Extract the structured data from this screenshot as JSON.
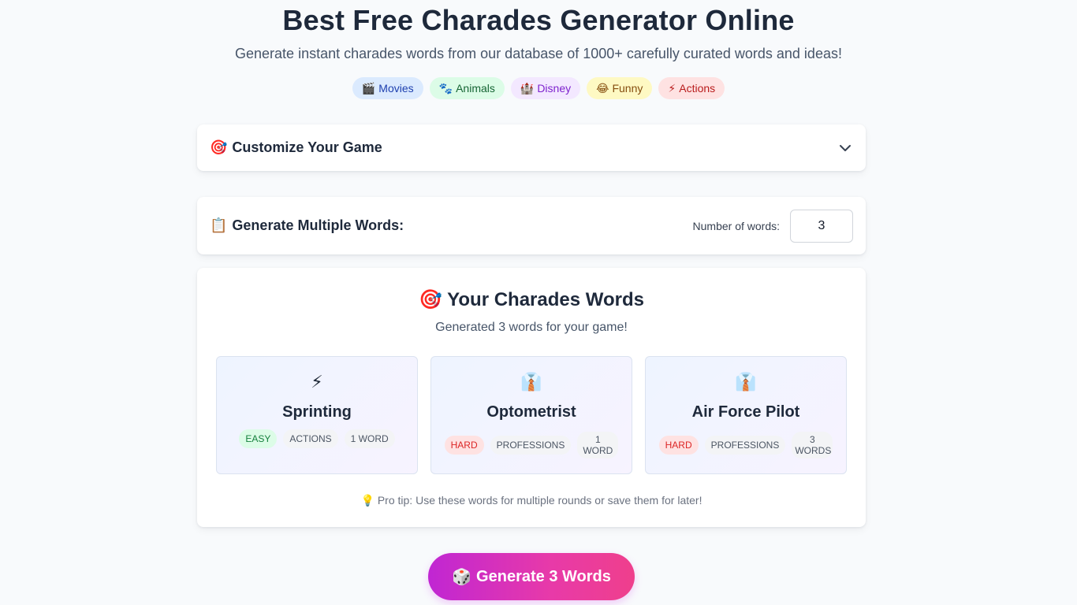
{
  "hero": {
    "title": "Best Free Charades Generator Online",
    "subtitle": "Generate instant charades words from our database of 1000+ carefully curated words and ideas!"
  },
  "categories": [
    {
      "icon": "🎬",
      "label": "Movies"
    },
    {
      "icon": "🐾",
      "label": "Animals"
    },
    {
      "icon": "🏰",
      "label": "Disney"
    },
    {
      "icon": "😂",
      "label": "Funny"
    },
    {
      "icon": "⚡",
      "label": "Actions"
    }
  ],
  "customize": {
    "icon": "🎯",
    "label": "Customize Your Game"
  },
  "multiple": {
    "icon": "📋",
    "label": "Generate Multiple Words:",
    "count_label": "Number of words:",
    "count_value": "3"
  },
  "results": {
    "icon": "🎯",
    "title": "Your Charades Words",
    "subtitle": "Generated 3 words for your game!",
    "words": [
      {
        "icon": "⚡",
        "word": "Sprinting",
        "difficulty": "EASY",
        "category": "ACTIONS",
        "length": "1 WORD"
      },
      {
        "icon": "👔",
        "word": "Optometrist",
        "difficulty": "HARD",
        "category": "PROFESSIONS",
        "length": "1 WORD"
      },
      {
        "icon": "👔",
        "word": "Air Force Pilot",
        "difficulty": "HARD",
        "category": "PROFESSIONS",
        "length": "3 WORDS"
      }
    ],
    "tip_icon": "💡",
    "tip": "Pro tip: Use these words for multiple rounds or save them for later!"
  },
  "generate_button": {
    "icon": "🎲",
    "label": "Generate 3 Words"
  },
  "colors": {
    "background": "#f8fafc",
    "button_gradient_start": "#c026d3",
    "button_gradient_end": "#ef3f8c",
    "easy": "#15803d",
    "hard": "#dc2626"
  }
}
